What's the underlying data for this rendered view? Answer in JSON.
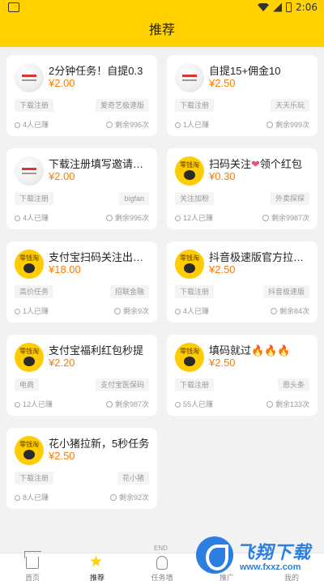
{
  "status": {
    "time": "2:06"
  },
  "header": {
    "title": "推荐"
  },
  "tasks": [
    {
      "title": "2分钟任务！自提0.3",
      "price": "¥2.00",
      "tag_left": "下载注册",
      "tag_right": "爱奇艺极速版",
      "count": "4人已赚",
      "remain": "剩余996次",
      "avatar": "white"
    },
    {
      "title": "自提15+佣金10",
      "price": "¥2.50",
      "tag_left": "下载注册",
      "tag_right": "天天乐玩",
      "count": "1人已赚",
      "remain": "剩余999次",
      "avatar": "white"
    },
    {
      "title": "下载注册填写邀请码…",
      "price": "¥2.00",
      "tag_left": "下载注册",
      "tag_right": "bigfan",
      "count": "4人已赚",
      "remain": "剩余996次",
      "avatar": "white"
    },
    {
      "title": "扫码关注",
      "title_suffix": "领个红包",
      "price": "¥0.30",
      "tag_left": "关注加粉",
      "tag_right": "外卖探探",
      "count": "12人已赚",
      "remain": "剩余9987次",
      "avatar": "yellow"
    },
    {
      "title": "支付宝扫码关注出额度",
      "price": "¥18.00",
      "tag_left": "高价任务",
      "tag_right": "招联金融",
      "count": "1人已赚",
      "remain": "剩余9次",
      "avatar": "yellow"
    },
    {
      "title": "抖音极速版官方拉新…",
      "price": "¥2.50",
      "tag_left": "下载注册",
      "tag_right": "抖音极速版",
      "count": "4人已赚",
      "remain": "剩余84次",
      "avatar": "yellow"
    },
    {
      "title": "支付宝福利红包秒提",
      "price": "¥2.20",
      "tag_left": "电商",
      "tag_right": "支付宝医保码",
      "count": "12人已赚",
      "remain": "剩余987次",
      "avatar": "yellow"
    },
    {
      "title": "填码就过",
      "price": "¥2.50",
      "tag_left": "下载注册",
      "tag_right": "恩头条",
      "count": "55人已赚",
      "remain": "剩余133次",
      "avatar": "yellow"
    },
    {
      "title": "花小猪拉新，5秒任务",
      "price": "¥2.50",
      "tag_left": "下载注册",
      "tag_right": "花小猪",
      "count": "8人已赚",
      "remain": "剩余92次",
      "avatar": "yellow"
    }
  ],
  "avatar_text": "零钱淘",
  "end_text": "END",
  "nav": [
    {
      "label": "首页",
      "icon": "home-icon"
    },
    {
      "label": "推荐",
      "icon": "star-icon"
    },
    {
      "label": "任务墙",
      "icon": "task-icon"
    },
    {
      "label": "推广",
      "icon": "share-icon"
    },
    {
      "label": "我的",
      "icon": "user-icon"
    }
  ],
  "watermark": {
    "text": "飞翔下载",
    "url": "www.fxxz.com"
  },
  "colors": {
    "brand": "#ffd200",
    "price": "#ff7a00"
  }
}
